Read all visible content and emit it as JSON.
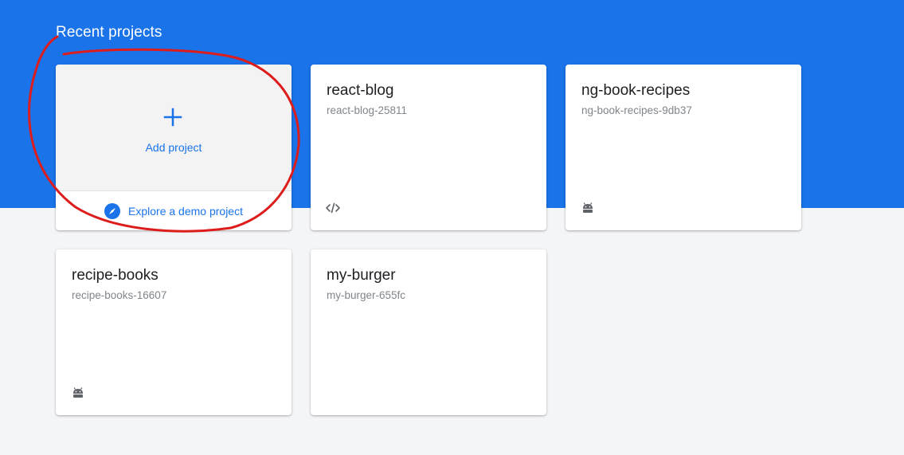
{
  "section": {
    "title": "Recent projects"
  },
  "add_card": {
    "plus_icon": "plus-icon",
    "label": "Add project",
    "demo_icon": "compass-icon",
    "demo_label": "Explore a demo project"
  },
  "projects": [
    {
      "name": "react-blog",
      "id": "react-blog-25811",
      "platform_icon": "code-icon"
    },
    {
      "name": "ng-book-recipes",
      "id": "ng-book-recipes-9db37",
      "platform_icon": "android-icon"
    },
    {
      "name": "recipe-books",
      "id": "recipe-books-16607",
      "platform_icon": "android-icon"
    },
    {
      "name": "my-burger",
      "id": "my-burger-655fc",
      "platform_icon": ""
    }
  ],
  "colors": {
    "header_blue": "#1a73e8",
    "accent_blue": "#1a73e8",
    "page_background": "#f4f5f7",
    "annotation_red": "#dd1c1c"
  }
}
